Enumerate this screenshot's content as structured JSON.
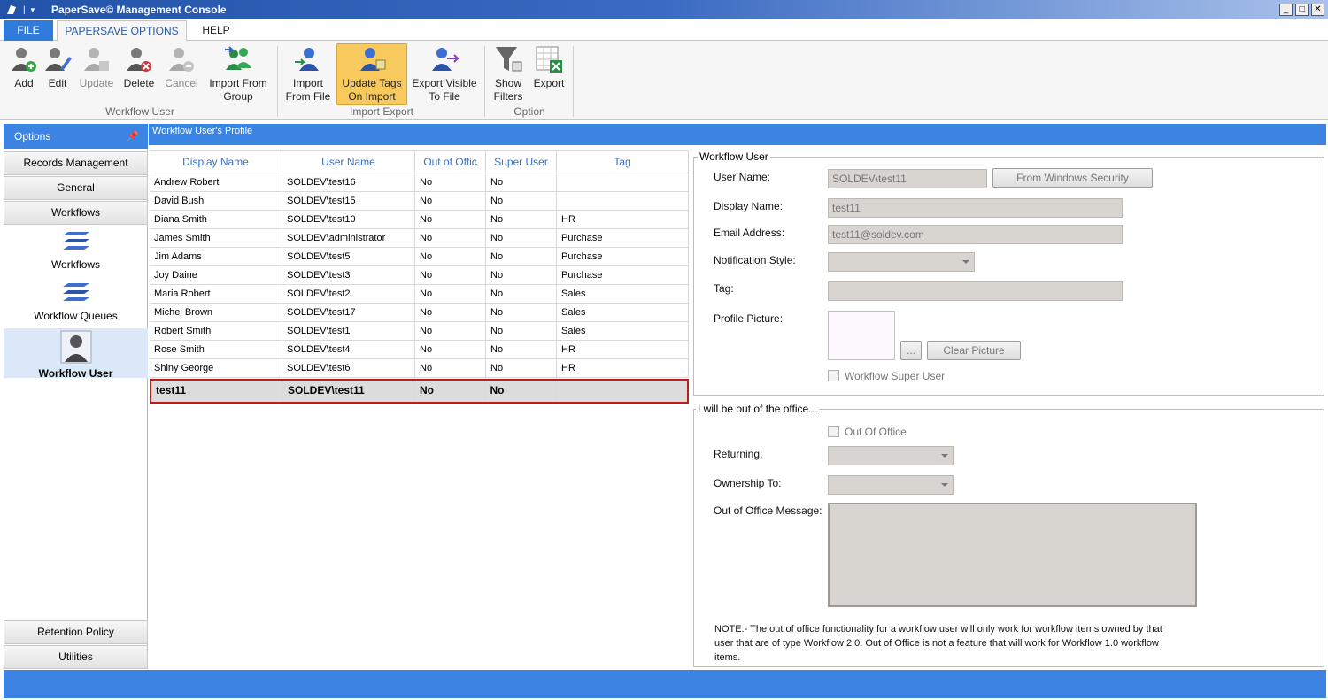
{
  "window": {
    "title": "PaperSave© Management Console"
  },
  "ribbon_tabs": {
    "file": "FILE",
    "papersave": "PAPERSAVE OPTIONS",
    "help": "HELP"
  },
  "ribbon": {
    "add": "Add",
    "edit": "Edit",
    "update": "Update",
    "delete": "Delete",
    "cancel": "Cancel",
    "import_group_1": "Import From",
    "import_group_2": "Group",
    "import_file_1": "Import",
    "import_file_2": "From File",
    "update_tags_1": "Update Tags",
    "update_tags_2": "On Import",
    "export_visible_1": "Export Visible",
    "export_visible_2": "To File",
    "show_filters_1": "Show",
    "show_filters_2": "Filters",
    "export": "Export",
    "group_workflow_user": "Workflow User",
    "group_import_export": "Import Export",
    "group_option": "Option"
  },
  "left_panel": {
    "header": "Options",
    "records_management": "Records Management",
    "general": "General",
    "workflows_section": "Workflows",
    "item_workflows": "Workflows",
    "item_workflow_queues": "Workflow Queues",
    "item_workflow_user": "Workflow User",
    "retention_policy": "Retention Policy",
    "utilities": "Utilities"
  },
  "main_header": "Workflow User's Profile",
  "grid": {
    "columns": [
      "Display Name",
      "User Name",
      "Out of Offic",
      "Super User",
      "Tag"
    ],
    "rows": [
      [
        "Andrew Robert",
        "SOLDEV\\test16",
        "No",
        "No",
        ""
      ],
      [
        "David Bush",
        "SOLDEV\\test15",
        "No",
        "No",
        ""
      ],
      [
        "Diana Smith",
        "SOLDEV\\test10",
        "No",
        "No",
        "HR"
      ],
      [
        "James Smith",
        "SOLDEV\\administrator",
        "No",
        "No",
        "Purchase"
      ],
      [
        "Jim Adams",
        "SOLDEV\\test5",
        "No",
        "No",
        "Purchase"
      ],
      [
        "Joy Daine",
        "SOLDEV\\test3",
        "No",
        "No",
        "Purchase"
      ],
      [
        "Maria Robert",
        "SOLDEV\\test2",
        "No",
        "No",
        "Sales"
      ],
      [
        "Michel Brown",
        "SOLDEV\\test17",
        "No",
        "No",
        "Sales"
      ],
      [
        "Robert Smith",
        "SOLDEV\\test1",
        "No",
        "No",
        "Sales"
      ],
      [
        "Rose Smith",
        "SOLDEV\\test4",
        "No",
        "No",
        "HR"
      ],
      [
        "Shiny George",
        "SOLDEV\\test6",
        "No",
        "No",
        "HR"
      ]
    ],
    "selected_row": [
      "test11",
      "SOLDEV\\test11",
      "No",
      "No",
      ""
    ]
  },
  "workflow_user_form": {
    "legend": "Workflow User",
    "user_name_label": "User Name:",
    "user_name_value": "SOLDEV\\test11",
    "from_windows_security": "From Windows Security",
    "display_name_label": "Display Name:",
    "display_name_value": "test11",
    "email_label": "Email Address:",
    "email_value": "test11@soldev.com",
    "notification_style_label": "Notification Style:",
    "tag_label": "Tag:",
    "profile_picture_label": "Profile Picture:",
    "browse_button": "...",
    "clear_picture": "Clear Picture",
    "super_user_label": "Workflow Super User"
  },
  "out_of_office_form": {
    "legend": "I will be out of the office...",
    "out_of_office_label": "Out Of Office",
    "returning_label": "Returning:",
    "ownership_label": "Ownership To:",
    "message_label": "Out of Office Message:",
    "note_line1": "NOTE:- The out of office functionality for a workflow user will only work for workflow items owned by that",
    "note_line2": "user that are of type Workflow 2.0.  Out of Office is not a feature that will work for Workflow 1.0 workflow",
    "note_line3": "items."
  }
}
